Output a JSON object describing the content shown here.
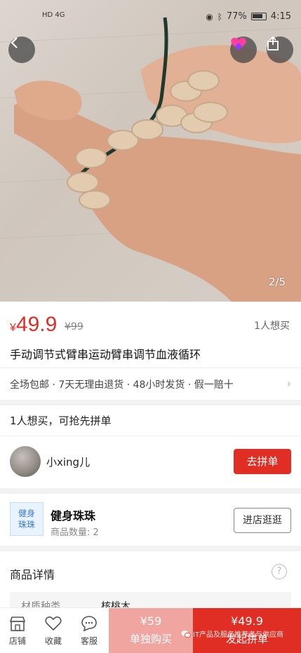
{
  "status": {
    "left_icons": "HD 4G",
    "battery_pct": "77%",
    "time": "4:15"
  },
  "gallery": {
    "counter": "2/5"
  },
  "product": {
    "price_symbol": "¥",
    "price": "49.9",
    "original_price": "¥99",
    "want_count": "1人想买",
    "title": "手动调节式臂串运动臂串调节血液循环",
    "tags": "全场包邮 · 7天无理由退货 · 48小时发货 · 假一赔十"
  },
  "group": {
    "headline": "1人想买，可抢先拼单",
    "user_name": "小xing儿",
    "join_label": "去拼单"
  },
  "shop": {
    "logo_line1": "健身",
    "logo_line2": "珠珠",
    "name": "健身珠珠",
    "count": "商品数量: 2",
    "visit_label": "进店逛逛"
  },
  "details": {
    "title": "商品详情",
    "help_glyph": "?",
    "attr_key": "材质种类",
    "attr_value": "核桃木"
  },
  "bottom": {
    "store_label": "店铺",
    "fav_label": "收藏",
    "cs_label": "客服",
    "single_price": "¥59",
    "single_label": "单独购买",
    "group_price": "¥49.9",
    "group_label": "发起拼单",
    "watermark": "IT产品及服务推荐者与供应商"
  },
  "colors": {
    "accent": "#e02e24",
    "single_buy_bg": "#f0a5a0"
  }
}
